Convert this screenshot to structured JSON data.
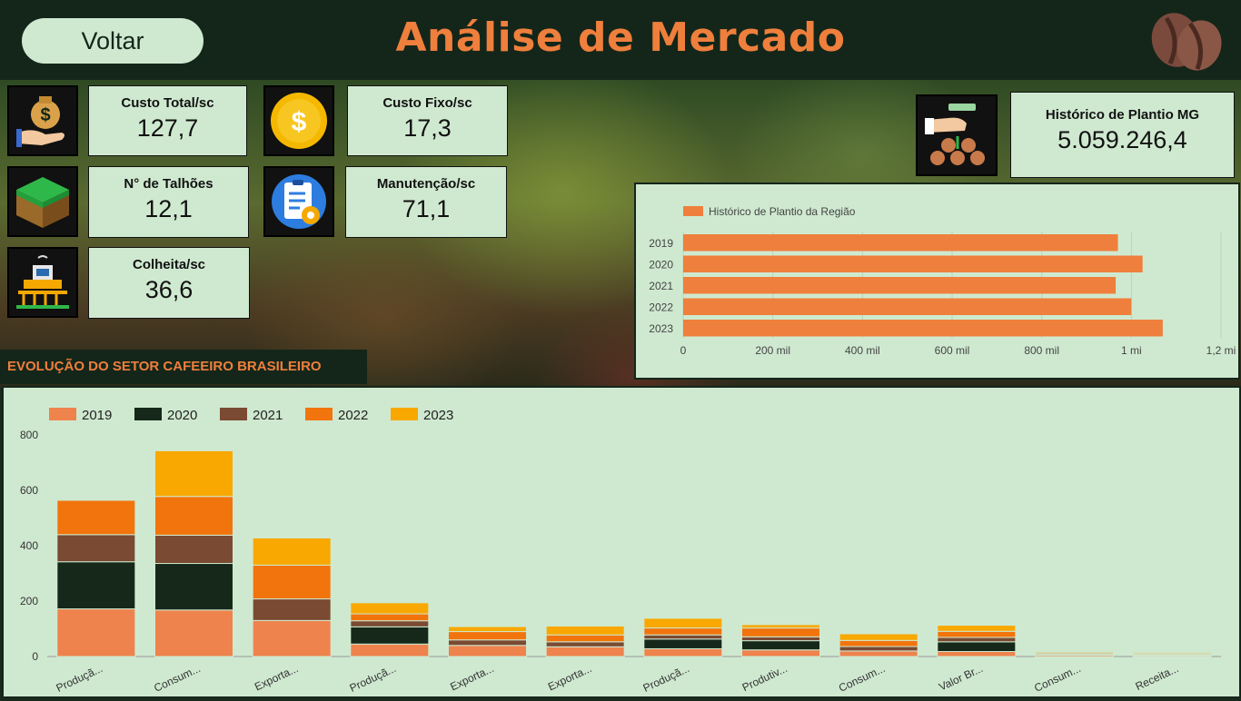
{
  "header": {
    "title": "Análise de Mercado",
    "back_label": "Voltar"
  },
  "kpis": {
    "custo_total": {
      "label": "Custo Total/sc",
      "value": "127,7"
    },
    "custo_fixo": {
      "label": "Custo Fixo/sc",
      "value": "17,3"
    },
    "talhoes": {
      "label": "N° de Talhões",
      "value": "12,1"
    },
    "manutencao": {
      "label": "Manutenção/sc",
      "value": "71,1"
    },
    "colheita": {
      "label": "Colheita/sc",
      "value": "36,6"
    },
    "historico_mg": {
      "label": "Histórico de Plantio MG",
      "value": "5.059.246,4"
    }
  },
  "section": {
    "title": "EVOLUÇÃO DO SETOR CAFEEIRO BRASILEIRO"
  },
  "colors": {
    "accent": "#ef7f3c",
    "dark": "#14261a",
    "panel": "#cfe9d0"
  },
  "chart_data": [
    {
      "type": "bar",
      "orientation": "horizontal",
      "legend": [
        "Histórico de Plantio da Região"
      ],
      "categories": [
        "2019",
        "2020",
        "2021",
        "2022",
        "2023"
      ],
      "values": [
        970000,
        1025000,
        965000,
        1000000,
        1070000
      ],
      "xticks": [
        "0",
        "200 mil",
        "400 mil",
        "600 mil",
        "800 mil",
        "1 mi",
        "1,2 mi"
      ],
      "xlim": [
        0,
        1200000
      ],
      "color": "#ef7f3c"
    },
    {
      "type": "bar",
      "stacked": true,
      "categories": [
        "Produçã...",
        "Consum...",
        "Exporta...",
        "Produçã...",
        "Exporta...",
        "Exporta...",
        "Produçã...",
        "Produtiv...",
        "Consum...",
        "Valor Br...",
        "Consum...",
        "Receita..."
      ],
      "series": [
        {
          "name": "2019",
          "color": "#ef834d",
          "values": [
            172,
            168,
            130,
            45,
            40,
            35,
            28,
            24,
            20,
            18,
            5,
            4
          ]
        },
        {
          "name": "2020",
          "color": "#15281a",
          "values": [
            170,
            168,
            0,
            62,
            0,
            0,
            35,
            33,
            0,
            35,
            0,
            0
          ]
        },
        {
          "name": "2021",
          "color": "#7a4a32",
          "values": [
            98,
            102,
            78,
            22,
            20,
            18,
            15,
            14,
            16,
            16,
            4,
            3
          ]
        },
        {
          "name": "2022",
          "color": "#f2740c",
          "values": [
            124,
            140,
            122,
            25,
            30,
            25,
            25,
            32,
            22,
            22,
            4,
            4
          ]
        },
        {
          "name": "2023",
          "color": "#f8a800",
          "values": [
            0,
            165,
            98,
            40,
            18,
            32,
            35,
            12,
            24,
            22,
            4,
            4
          ]
        }
      ],
      "ylim": [
        0,
        800
      ],
      "yticks": [
        "0",
        "200",
        "400",
        "600",
        "800"
      ],
      "legend_position": "top-left"
    }
  ]
}
